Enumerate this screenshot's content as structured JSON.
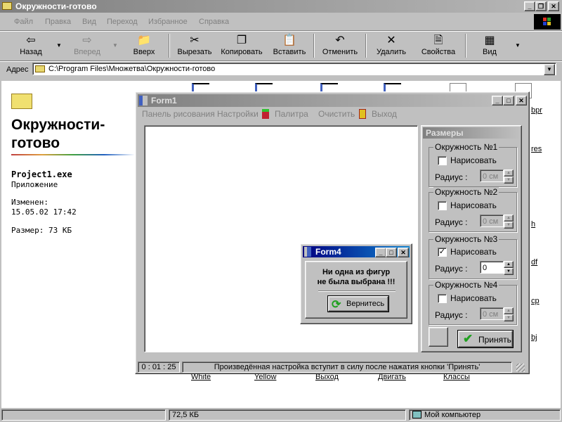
{
  "window": {
    "title": "Окружности-готово"
  },
  "menu": [
    {
      "label": "Файл"
    },
    {
      "label": "Правка"
    },
    {
      "label": "Вид"
    },
    {
      "label": "Переход"
    },
    {
      "label": "Избранное"
    },
    {
      "label": "Справка"
    }
  ],
  "toolbar": {
    "back": "Назад",
    "forward": "Вперед",
    "up": "Вверх",
    "cut": "Вырезать",
    "copy": "Копировать",
    "paste": "Вставить",
    "undo": "Отменить",
    "delete": "Удалить",
    "properties": "Свойства",
    "view": "Вид"
  },
  "address": {
    "label": "Адрес",
    "value": "C:\\Program Files\\Множетва\\Окружности-готово"
  },
  "webview": {
    "folder_title": "Окружности-готово",
    "file_name": "Project1.exe",
    "file_type": "Приложение",
    "modified_label": "Изменен:",
    "modified_value": "15.05.02 17:42",
    "size": "Размер: 73 КБ"
  },
  "file_labels": [
    "White",
    "Yellow",
    "Выход",
    "Двигать",
    "Классы"
  ],
  "file_label_fragments": [
    "bpr",
    "res",
    "h",
    "df",
    "cp",
    "bj"
  ],
  "statusbar": {
    "size": "72,5 КБ",
    "location": "Мой компьютер"
  },
  "form1": {
    "title": "Form1",
    "menu": {
      "draw_panel": "Панель рисования",
      "settings": "Настройки",
      "palette": "Палитра",
      "clear": "Очистить",
      "exit": "Выход"
    },
    "sizes_title": "Размеры",
    "circles": [
      {
        "title": "Окружность №1",
        "draw_label": "Нарисовать",
        "checked": false,
        "radius_label": "Радиус :",
        "radius": "0 см",
        "enabled": false
      },
      {
        "title": "Окружность №2",
        "draw_label": "Нарисовать",
        "checked": false,
        "radius_label": "Радиус :",
        "radius": "0 см",
        "enabled": false
      },
      {
        "title": "Окружность №3",
        "draw_label": "Нарисовать",
        "checked": true,
        "radius_label": "Радиус :",
        "radius": "0",
        "enabled": true
      },
      {
        "title": "Окружность №4",
        "draw_label": "Нарисовать",
        "checked": false,
        "radius_label": "Радиус :",
        "radius": "0 см",
        "enabled": false
      }
    ],
    "accept_label": "Принять",
    "status_time": "0 : 01 : 25",
    "status_message": "Произведённая настройка вступит в силу после нажатия кнопки 'Принять'"
  },
  "form4": {
    "title": "Form4",
    "message_line1": "Ни одна из фигур",
    "message_line2": "не была выбрана !!!",
    "button_label": "Вернитесь"
  }
}
